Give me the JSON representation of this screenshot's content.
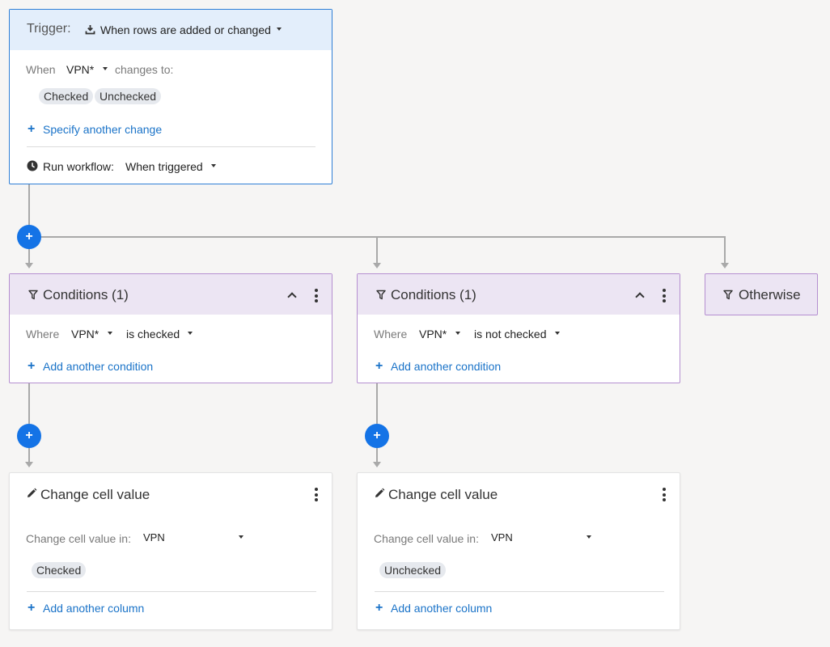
{
  "trigger": {
    "label": "Trigger:",
    "type": "When rows are added or changed",
    "when_label": "When",
    "column": "VPN*",
    "changes_to_label": "changes to:",
    "values": [
      "Checked",
      "Unchecked"
    ],
    "specify_another": "Specify another change",
    "run_label": "Run workflow:",
    "run_value": "When triggered"
  },
  "branches": [
    {
      "title": "Conditions (1)",
      "where_label": "Where",
      "column": "VPN*",
      "operator": "is checked",
      "add_condition": "Add another condition",
      "action": {
        "title": "Change cell value",
        "field_label": "Change cell value in:",
        "column": "VPN",
        "value": "Checked",
        "add_column": "Add another column"
      }
    },
    {
      "title": "Conditions (1)",
      "where_label": "Where",
      "column": "VPN*",
      "operator": "is not checked",
      "add_condition": "Add another condition",
      "action": {
        "title": "Change cell value",
        "field_label": "Change cell value in:",
        "column": "VPN",
        "value": "Unchecked",
        "add_column": "Add another column"
      }
    }
  ],
  "otherwise": {
    "title": "Otherwise"
  },
  "colors": {
    "accent_blue": "#1473e6",
    "link_blue": "#1a73c8",
    "trigger_border": "#2f7fd6",
    "condition_border": "#b58fd0",
    "condition_header": "#ece5f3",
    "trigger_header": "#e3eefb",
    "canvas": "#f6f5f4"
  },
  "icons": [
    "download-icon",
    "clock-icon",
    "filter-icon",
    "pencil-icon",
    "kebab-menu-icon",
    "chevron-up-icon",
    "plus-icon",
    "caret-down-icon"
  ]
}
